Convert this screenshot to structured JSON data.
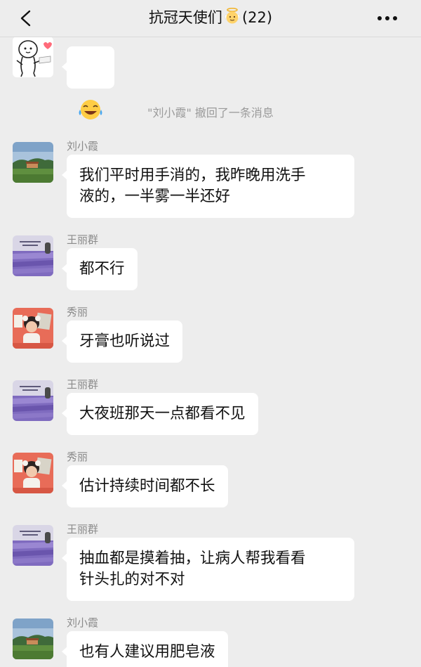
{
  "header": {
    "title": "抗冠天使们",
    "member_count": "(22)",
    "title_icon": "angel-emoji-icon",
    "back_icon": "chevron-left-icon",
    "more_icon": "more-dots-icon"
  },
  "system_notice": "\"刘小霞\" 撤回了一条消息",
  "messages": [
    {
      "sender": "",
      "avatar": "cartoon-sticker-avatar",
      "content_icon": "laughing-tears-emoji-icon"
    },
    {
      "sender": "刘小霞",
      "avatar": "landscape-avatar",
      "text": "我们平时用手消的，我昨晚用洗手\n液的，一半雾一半还好"
    },
    {
      "sender": "王丽群",
      "avatar": "lavender-field-avatar",
      "text": "都不行"
    },
    {
      "sender": "秀丽",
      "avatar": "girl-photo-avatar",
      "text": "牙膏也听说过"
    },
    {
      "sender": "王丽群",
      "avatar": "lavender-field-avatar",
      "text": "大夜班那天一点都看不见"
    },
    {
      "sender": "秀丽",
      "avatar": "girl-photo-avatar",
      "text": "估计持续时间都不长"
    },
    {
      "sender": "王丽群",
      "avatar": "lavender-field-avatar",
      "text": "抽血都是摸着抽，让病人帮我看看\n针头扎的对不对"
    },
    {
      "sender": "刘小霞",
      "avatar": "landscape-avatar",
      "text": "也有人建议用肥皂液"
    }
  ],
  "colors": {
    "background": "#ededed",
    "bubble": "#ffffff",
    "sender_name": "#8a8a8a",
    "system_text": "#9a9a9a"
  }
}
